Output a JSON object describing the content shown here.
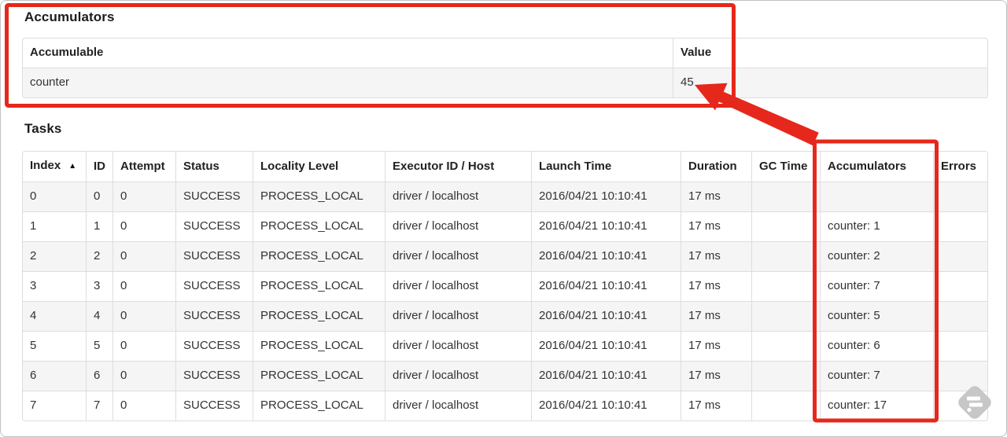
{
  "accumulators": {
    "title": "Accumulators",
    "headers": [
      "Accumulable",
      "Value"
    ],
    "rows": [
      [
        "counter",
        "45"
      ]
    ]
  },
  "tasks": {
    "title": "Tasks",
    "sort_indicator": "▲",
    "headers": [
      "Index",
      "ID",
      "Attempt",
      "Status",
      "Locality Level",
      "Executor ID / Host",
      "Launch Time",
      "Duration",
      "GC Time",
      "Accumulators",
      "Errors"
    ],
    "rows": [
      [
        "0",
        "0",
        "0",
        "SUCCESS",
        "PROCESS_LOCAL",
        "driver / localhost",
        "2016/04/21 10:10:41",
        "17 ms",
        "",
        "",
        ""
      ],
      [
        "1",
        "1",
        "0",
        "SUCCESS",
        "PROCESS_LOCAL",
        "driver / localhost",
        "2016/04/21 10:10:41",
        "17 ms",
        "",
        "counter: 1",
        ""
      ],
      [
        "2",
        "2",
        "0",
        "SUCCESS",
        "PROCESS_LOCAL",
        "driver / localhost",
        "2016/04/21 10:10:41",
        "17 ms",
        "",
        "counter: 2",
        ""
      ],
      [
        "3",
        "3",
        "0",
        "SUCCESS",
        "PROCESS_LOCAL",
        "driver / localhost",
        "2016/04/21 10:10:41",
        "17 ms",
        "",
        "counter: 7",
        ""
      ],
      [
        "4",
        "4",
        "0",
        "SUCCESS",
        "PROCESS_LOCAL",
        "driver / localhost",
        "2016/04/21 10:10:41",
        "17 ms",
        "",
        "counter: 5",
        ""
      ],
      [
        "5",
        "5",
        "0",
        "SUCCESS",
        "PROCESS_LOCAL",
        "driver / localhost",
        "2016/04/21 10:10:41",
        "17 ms",
        "",
        "counter: 6",
        ""
      ],
      [
        "6",
        "6",
        "0",
        "SUCCESS",
        "PROCESS_LOCAL",
        "driver / localhost",
        "2016/04/21 10:10:41",
        "17 ms",
        "",
        "counter: 7",
        ""
      ],
      [
        "7",
        "7",
        "0",
        "SUCCESS",
        "PROCESS_LOCAL",
        "driver / localhost",
        "2016/04/21 10:10:41",
        "17 ms",
        "",
        "counter: 17",
        ""
      ]
    ]
  },
  "annotations": {
    "accent_color": "#e5281b"
  },
  "watermark": {
    "color": "#c7c7c7"
  }
}
